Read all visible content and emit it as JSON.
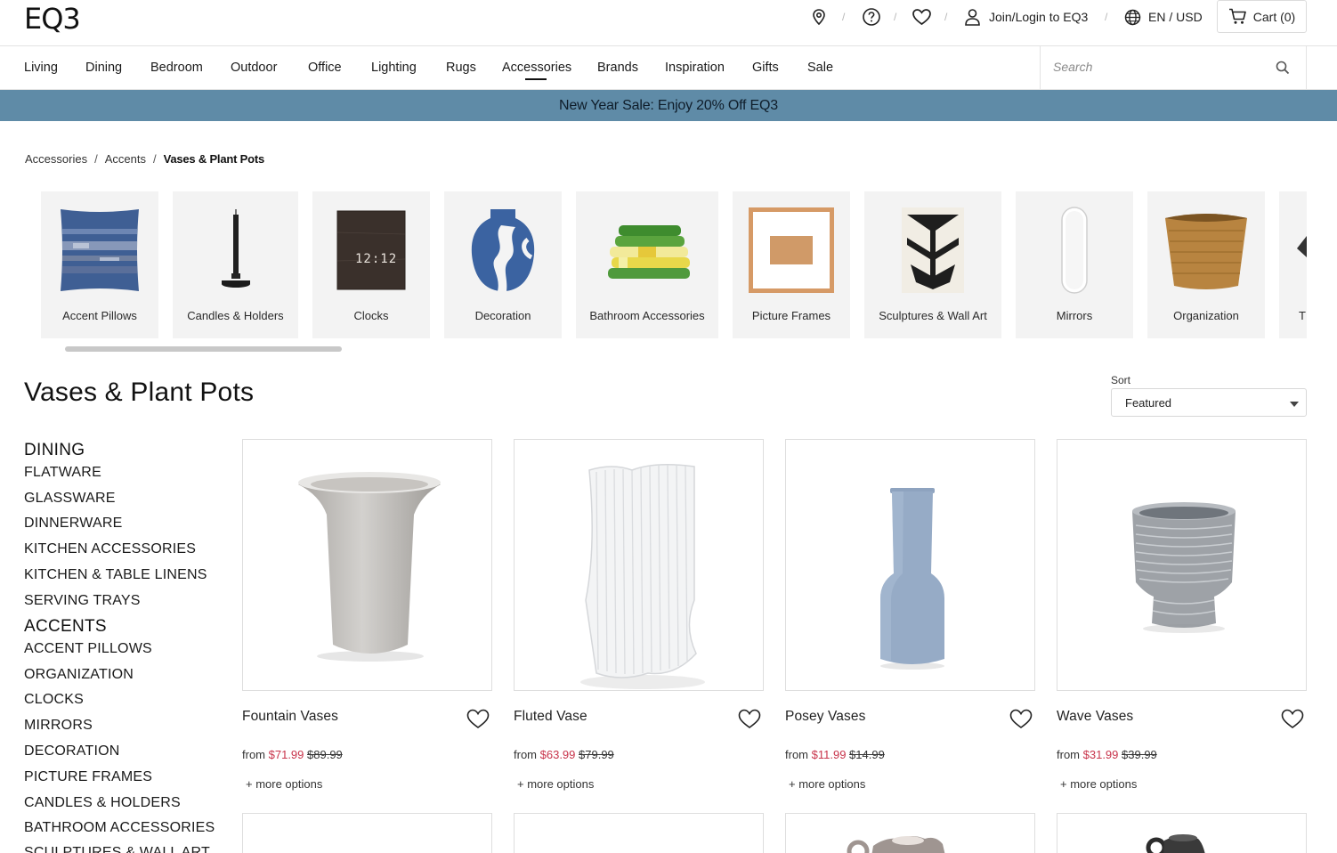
{
  "brand": {
    "logo": "EQ3"
  },
  "header": {
    "login_label": "Join/Login to EQ3",
    "locale_label": "EN / USD",
    "cart_label": "Cart (0)",
    "separator": "/"
  },
  "nav": {
    "items": [
      "Living",
      "Dining",
      "Bedroom",
      "Outdoor",
      "Office",
      "Lighting",
      "Rugs",
      "Accessories",
      "Brands",
      "Inspiration",
      "Gifts",
      "Sale"
    ],
    "active": "Accessories"
  },
  "search": {
    "placeholder": "Search"
  },
  "promo": {
    "text": "New Year Sale: Enjoy 20% Off EQ3"
  },
  "breadcrumb": {
    "items": [
      "Accessories",
      "Accents"
    ],
    "current": "Vases & Plant Pots",
    "separator": "/"
  },
  "categories": [
    {
      "label": "Accent Pillows"
    },
    {
      "label": "Candles & Holders"
    },
    {
      "label": "Clocks",
      "clock_text": "12:12"
    },
    {
      "label": "Decoration"
    },
    {
      "label": "Bathroom Accessories"
    },
    {
      "label": "Picture Frames"
    },
    {
      "label": "Sculptures & Wall Art"
    },
    {
      "label": "Mirrors"
    },
    {
      "label": "Organization"
    },
    {
      "label": "T"
    }
  ],
  "page": {
    "title": "Vases & Plant Pots"
  },
  "sort": {
    "label": "Sort",
    "value": "Featured"
  },
  "sidebar": {
    "groups": [
      {
        "heading": "DINING",
        "items": [
          "FLATWARE",
          "GLASSWARE",
          "DINNERWARE",
          "KITCHEN ACCESSORIES",
          "KITCHEN & TABLE LINENS",
          "SERVING TRAYS"
        ]
      },
      {
        "heading": "ACCENTS",
        "items": [
          "ACCENT PILLOWS",
          "ORGANIZATION",
          "CLOCKS",
          "MIRRORS",
          "DECORATION",
          "PICTURE FRAMES",
          "CANDLES & HOLDERS",
          "BATHROOM ACCESSORIES",
          "SCULPTURES & WALL ART"
        ]
      }
    ]
  },
  "products": [
    {
      "name": "Fountain Vases",
      "from": "from",
      "sale_price": "$71.99",
      "original_price": "$89.99",
      "more": "+ more options"
    },
    {
      "name": "Fluted Vase",
      "from": "from",
      "sale_price": "$63.99",
      "original_price": "$79.99",
      "more": "+ more options"
    },
    {
      "name": "Posey Vases",
      "from": "from",
      "sale_price": "$11.99",
      "original_price": "$14.99",
      "more": "+ more options"
    },
    {
      "name": "Wave Vases",
      "from": "from",
      "sale_price": "$31.99",
      "original_price": "$39.99",
      "more": "+ more options"
    }
  ],
  "colors": {
    "promo_bg": "#5f8ba7",
    "sale_price": "#c8344b",
    "tile_bg": "#f3f3f3",
    "posey_blue": "#96abc6"
  }
}
